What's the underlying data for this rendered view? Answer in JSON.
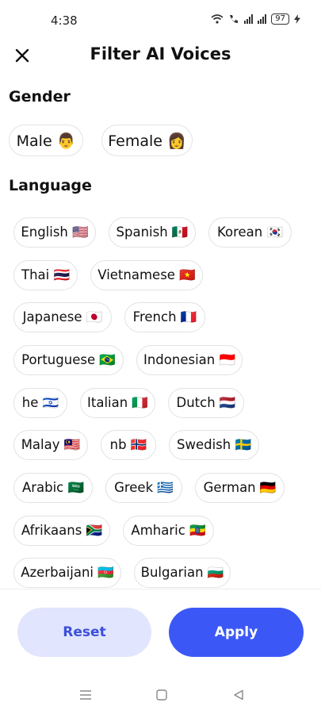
{
  "status": {
    "time": "4:38",
    "battery": "97"
  },
  "header": {
    "title": "Filter AI Voices"
  },
  "gender": {
    "title": "Gender",
    "options": [
      {
        "label": "Male 👨"
      },
      {
        "label": "Female 👩"
      }
    ]
  },
  "language": {
    "title": "Language",
    "options": [
      {
        "label": "English 🇺🇸"
      },
      {
        "label": "Spanish 🇲🇽"
      },
      {
        "label": "Korean 🇰🇷"
      },
      {
        "label": "Thai 🇹🇭"
      },
      {
        "label": "Vietnamese 🇻🇳"
      },
      {
        "label": "Japanese 🇯🇵"
      },
      {
        "label": "French 🇫🇷"
      },
      {
        "label": "Portuguese 🇧🇷"
      },
      {
        "label": "Indonesian 🇮🇩"
      },
      {
        "label": "he 🇮🇱"
      },
      {
        "label": "Italian 🇮🇹"
      },
      {
        "label": "Dutch 🇳🇱"
      },
      {
        "label": "Malay 🇲🇾"
      },
      {
        "label": "nb 🇳🇴"
      },
      {
        "label": "Swedish 🇸🇪"
      },
      {
        "label": "Arabic 🇸🇦"
      },
      {
        "label": "Greek 🇬🇷"
      },
      {
        "label": "German 🇩🇪"
      },
      {
        "label": "Afrikaans 🇿🇦"
      },
      {
        "label": "Amharic 🇪🇹"
      },
      {
        "label": "Azerbaijani 🇦🇿"
      },
      {
        "label": "Bulgarian 🇧🇬"
      }
    ]
  },
  "actions": {
    "reset_label": "Reset",
    "apply_label": "Apply"
  },
  "colors": {
    "primary": "#3b58f6",
    "secondary_bg": "#e1e5fd"
  }
}
